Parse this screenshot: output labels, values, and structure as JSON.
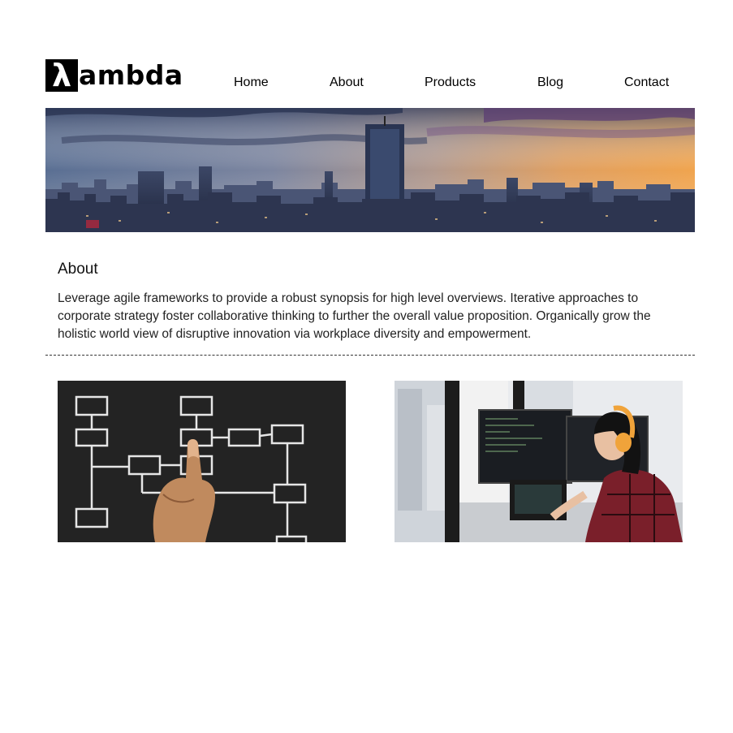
{
  "logo": {
    "symbol": "λ",
    "wordmark": "ambda"
  },
  "nav": {
    "items": [
      "Home",
      "About",
      "Products",
      "Blog",
      "Contact"
    ]
  },
  "about": {
    "title": "About",
    "body": "Leverage agile frameworks to provide a robust synopsis for high level overviews. Iterative approaches to corporate strategy foster collaborative thinking to further the overall value proposition. Organically grow the holistic world view of disruptive innovation via workplace diversity and empowerment."
  },
  "images": {
    "banner": "city-skyline-sunset",
    "left": "hand-drawing-flowchart-on-chalkboard",
    "right": "woman-with-headphones-coding-at-multiple-monitors"
  },
  "colors": {
    "text": "#111111",
    "logo_bg": "#000000",
    "divider": "#333333"
  }
}
